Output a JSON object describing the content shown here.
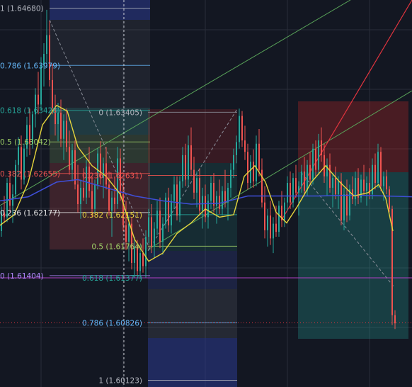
{
  "chart_data": {
    "type": "candlestick",
    "price_axis": {
      "min": 1.6004,
      "max": 1.6478
    },
    "grid": true,
    "colors": {
      "background": "#131722",
      "grid": "#2a2e39",
      "up": "#26a69a",
      "down": "#ef5350",
      "sma_fast": "#e6d53c",
      "sma_slow": "#3f4fd8",
      "trend_green": "#5aa55a",
      "trend_red": "#e0343e",
      "dashed": "#8a8e99",
      "fib_labels": [
        "#b2b5be",
        "#64b5f6",
        "#26a69a",
        "#9ccc65",
        "#ef5350",
        "#e8e8e8",
        "#b388ff"
      ]
    },
    "fib_left": [
      {
        "label": "1 (1.64680)",
        "price": 1.6468
      },
      {
        "label": "0.786 (1.63979)",
        "price": 1.63979
      },
      {
        "label": "0.618 (1.63428)",
        "price": 1.63428
      },
      {
        "label": "0.5 (1.63042)",
        "price": 1.63042
      },
      {
        "label": "0.382 (1.62655)",
        "price": 1.62655
      },
      {
        "label": "0.236 (1.62177)",
        "price": 1.62177
      },
      {
        "label": "0 (1.61404)",
        "price": 1.61404
      }
    ],
    "fib_mid": [
      {
        "label": "0 (1.63405)",
        "price": 1.63405
      },
      {
        "label": "0.236 (1.62631)",
        "price": 1.62631
      },
      {
        "label": "0.382 (1.62151)",
        "price": 1.62151
      },
      {
        "label": "0.5 (1.61764)",
        "price": 1.61764
      },
      {
        "label": "0.618 (1.61377)",
        "price": 1.61377
      },
      {
        "label": "0.786 (1.60826)",
        "price": 1.60826
      },
      {
        "label": "1 (1.60123)",
        "price": 1.60123
      }
    ],
    "horizontal_levels": {
      "magenta": 1.61377,
      "red_dotted": 1.60826
    },
    "sma_fast": [
      [
        0,
        1.6202
      ],
      [
        20,
        1.6215
      ],
      [
        40,
        1.6255
      ],
      [
        60,
        1.6325
      ],
      [
        80,
        1.6349
      ],
      [
        95,
        1.6342
      ],
      [
        110,
        1.6298
      ],
      [
        130,
        1.6275
      ],
      [
        150,
        1.6262
      ],
      [
        170,
        1.624
      ],
      [
        190,
        1.6185
      ],
      [
        210,
        1.6158
      ],
      [
        230,
        1.6168
      ],
      [
        250,
        1.6192
      ],
      [
        270,
        1.6205
      ],
      [
        290,
        1.6222
      ],
      [
        310,
        1.6212
      ],
      [
        330,
        1.6215
      ],
      [
        345,
        1.6262
      ],
      [
        360,
        1.6275
      ],
      [
        375,
        1.6255
      ],
      [
        390,
        1.6218
      ],
      [
        405,
        1.6205
      ],
      [
        420,
        1.6225
      ],
      [
        440,
        1.6255
      ],
      [
        460,
        1.6275
      ],
      [
        480,
        1.6255
      ],
      [
        500,
        1.6238
      ],
      [
        520,
        1.6242
      ],
      [
        535,
        1.6252
      ],
      [
        545,
        1.6235
      ],
      [
        555,
        1.6195
      ]
    ],
    "sma_slow": [
      [
        0,
        1.6232
      ],
      [
        40,
        1.6237
      ],
      [
        80,
        1.6255
      ],
      [
        110,
        1.6258
      ],
      [
        150,
        1.6248
      ],
      [
        190,
        1.6238
      ],
      [
        230,
        1.6232
      ],
      [
        270,
        1.6228
      ],
      [
        310,
        1.6229
      ],
      [
        350,
        1.6238
      ],
      [
        400,
        1.6238
      ],
      [
        450,
        1.6238
      ],
      [
        500,
        1.6239
      ],
      [
        545,
        1.6238
      ],
      [
        582,
        1.6237
      ]
    ],
    "ohlc": [
      [
        2,
        1.6195,
        1.6225,
        1.6188,
        1.6218
      ],
      [
        6,
        1.6218,
        1.6238,
        1.6205,
        1.6212
      ],
      [
        10,
        1.6212,
        1.626,
        1.6206,
        1.6254
      ],
      [
        14,
        1.6254,
        1.6268,
        1.6218,
        1.6226
      ],
      [
        18,
        1.6226,
        1.6252,
        1.6205,
        1.624
      ],
      [
        22,
        1.624,
        1.6282,
        1.6234,
        1.6276
      ],
      [
        26,
        1.6276,
        1.631,
        1.6262,
        1.6298
      ],
      [
        30,
        1.6298,
        1.6312,
        1.6246,
        1.6258
      ],
      [
        34,
        1.6258,
        1.6302,
        1.6252,
        1.6296
      ],
      [
        38,
        1.6296,
        1.6335,
        1.6286,
        1.6325
      ],
      [
        42,
        1.6325,
        1.6345,
        1.6288,
        1.6302
      ],
      [
        46,
        1.6302,
        1.6342,
        1.6296,
        1.6338
      ],
      [
        50,
        1.6338,
        1.637,
        1.6322,
        1.6362
      ],
      [
        54,
        1.6362,
        1.639,
        1.6338,
        1.635
      ],
      [
        58,
        1.635,
        1.6408,
        1.6344,
        1.6398
      ],
      [
        62,
        1.6398,
        1.6425,
        1.6372,
        1.6412
      ],
      [
        66,
        1.6412,
        1.6466,
        1.6395,
        1.6435
      ],
      [
        70,
        1.6435,
        1.6452,
        1.6372,
        1.638
      ],
      [
        74,
        1.638,
        1.64,
        1.6338,
        1.6346
      ],
      [
        78,
        1.6346,
        1.6362,
        1.6312,
        1.6326
      ],
      [
        82,
        1.6326,
        1.6352,
        1.6305,
        1.634
      ],
      [
        86,
        1.634,
        1.6356,
        1.6298,
        1.6308
      ],
      [
        90,
        1.6308,
        1.6338,
        1.6282,
        1.633
      ],
      [
        94,
        1.633,
        1.6345,
        1.6292,
        1.6298
      ],
      [
        98,
        1.6298,
        1.6318,
        1.6264,
        1.627
      ],
      [
        102,
        1.627,
        1.6302,
        1.6256,
        1.6294
      ],
      [
        106,
        1.6294,
        1.6306,
        1.6246,
        1.6252
      ],
      [
        110,
        1.6252,
        1.6276,
        1.6218,
        1.6228
      ],
      [
        114,
        1.6228,
        1.6258,
        1.621,
        1.6248
      ],
      [
        118,
        1.6248,
        1.6272,
        1.6232,
        1.6236
      ],
      [
        122,
        1.6236,
        1.6282,
        1.6228,
        1.6274
      ],
      [
        126,
        1.6274,
        1.6298,
        1.6236,
        1.6244
      ],
      [
        130,
        1.6244,
        1.6262,
        1.6212,
        1.6222
      ],
      [
        134,
        1.6222,
        1.6258,
        1.6216,
        1.6252
      ],
      [
        138,
        1.6252,
        1.6296,
        1.6246,
        1.629
      ],
      [
        142,
        1.629,
        1.6305,
        1.6252,
        1.626
      ],
      [
        146,
        1.626,
        1.6285,
        1.6235,
        1.6278
      ],
      [
        150,
        1.6278,
        1.6298,
        1.6246,
        1.6252
      ],
      [
        154,
        1.6252,
        1.6268,
        1.6214,
        1.622
      ],
      [
        158,
        1.622,
        1.6244,
        1.6188,
        1.6236
      ],
      [
        162,
        1.6236,
        1.6262,
        1.6218,
        1.6228
      ],
      [
        166,
        1.6228,
        1.6298,
        1.6222,
        1.6284
      ],
      [
        170,
        1.6284,
        1.6296,
        1.6232,
        1.624
      ],
      [
        174,
        1.624,
        1.6256,
        1.6195,
        1.6202
      ],
      [
        178,
        1.6202,
        1.6232,
        1.6172,
        1.6182
      ],
      [
        182,
        1.6182,
        1.6214,
        1.6158,
        1.6204
      ],
      [
        186,
        1.6204,
        1.6212,
        1.6148,
        1.6156
      ],
      [
        190,
        1.6156,
        1.6188,
        1.6138,
        1.6176
      ],
      [
        194,
        1.6176,
        1.6184,
        1.614,
        1.6146
      ],
      [
        198,
        1.6146,
        1.6178,
        1.6136,
        1.6168
      ],
      [
        202,
        1.6168,
        1.6186,
        1.6144,
        1.6152
      ],
      [
        206,
        1.6152,
        1.6196,
        1.6138,
        1.6188
      ],
      [
        210,
        1.6188,
        1.6222,
        1.618,
        1.6212
      ],
      [
        214,
        1.6212,
        1.6228,
        1.6168,
        1.6176
      ],
      [
        218,
        1.6176,
        1.6206,
        1.6162,
        1.6198
      ],
      [
        222,
        1.6198,
        1.6232,
        1.619,
        1.622
      ],
      [
        226,
        1.622,
        1.6236,
        1.6174,
        1.6182
      ],
      [
        230,
        1.6182,
        1.6212,
        1.6166,
        1.6204
      ],
      [
        234,
        1.6204,
        1.6242,
        1.6198,
        1.6236
      ],
      [
        238,
        1.6236,
        1.6248,
        1.6194,
        1.6202
      ],
      [
        242,
        1.6202,
        1.624,
        1.6192,
        1.6232
      ],
      [
        246,
        1.6232,
        1.6262,
        1.6222,
        1.6252
      ],
      [
        250,
        1.6252,
        1.6262,
        1.6208,
        1.6214
      ],
      [
        254,
        1.6214,
        1.6262,
        1.6206,
        1.6256
      ],
      [
        258,
        1.6256,
        1.6298,
        1.6248,
        1.6288
      ],
      [
        262,
        1.6288,
        1.6302,
        1.625,
        1.6258
      ],
      [
        266,
        1.6258,
        1.6312,
        1.625,
        1.63
      ],
      [
        270,
        1.63,
        1.6322,
        1.6262,
        1.627
      ],
      [
        274,
        1.627,
        1.6286,
        1.6234,
        1.6242
      ],
      [
        278,
        1.6242,
        1.6268,
        1.6224,
        1.626
      ],
      [
        282,
        1.626,
        1.6272,
        1.6214,
        1.622
      ],
      [
        286,
        1.622,
        1.6248,
        1.6198,
        1.6238
      ],
      [
        290,
        1.6238,
        1.6252,
        1.6206,
        1.6212
      ],
      [
        294,
        1.6212,
        1.624,
        1.6198,
        1.6232
      ],
      [
        298,
        1.6232,
        1.6262,
        1.6222,
        1.6254
      ],
      [
        302,
        1.6254,
        1.6266,
        1.6218,
        1.6226
      ],
      [
        306,
        1.6226,
        1.6244,
        1.6204,
        1.6238
      ],
      [
        310,
        1.6238,
        1.6258,
        1.6216,
        1.6222
      ],
      [
        314,
        1.6222,
        1.625,
        1.6214,
        1.6244
      ],
      [
        318,
        1.6244,
        1.627,
        1.6224,
        1.623
      ],
      [
        322,
        1.623,
        1.6254,
        1.6208,
        1.6248
      ],
      [
        326,
        1.6248,
        1.6278,
        1.6236,
        1.627
      ],
      [
        330,
        1.627,
        1.6296,
        1.626,
        1.6288
      ],
      [
        334,
        1.6288,
        1.6312,
        1.6278,
        1.6304
      ],
      [
        338,
        1.6304,
        1.6345,
        1.6296,
        1.6336
      ],
      [
        342,
        1.6336,
        1.6342,
        1.6298,
        1.6306
      ],
      [
        346,
        1.6306,
        1.6324,
        1.6282,
        1.6292
      ],
      [
        350,
        1.6292,
        1.6302,
        1.6246,
        1.6254
      ],
      [
        354,
        1.6254,
        1.6288,
        1.6248,
        1.628
      ],
      [
        358,
        1.628,
        1.6295,
        1.6248,
        1.6256
      ],
      [
        362,
        1.6256,
        1.6312,
        1.625,
        1.6302
      ],
      [
        366,
        1.6302,
        1.632,
        1.6262,
        1.627
      ],
      [
        370,
        1.627,
        1.6284,
        1.6224,
        1.623
      ],
      [
        374,
        1.623,
        1.625,
        1.6186,
        1.6196
      ],
      [
        378,
        1.6196,
        1.6222,
        1.6176,
        1.6214
      ],
      [
        382,
        1.6214,
        1.6232,
        1.6178,
        1.6186
      ],
      [
        386,
        1.6186,
        1.6212,
        1.6168,
        1.6204
      ],
      [
        390,
        1.6204,
        1.6226,
        1.6188,
        1.6194
      ],
      [
        394,
        1.6194,
        1.6232,
        1.6188,
        1.6226
      ],
      [
        398,
        1.6226,
        1.6244,
        1.62,
        1.6208
      ],
      [
        402,
        1.6208,
        1.6236,
        1.62,
        1.623
      ],
      [
        406,
        1.623,
        1.6262,
        1.622,
        1.6254
      ],
      [
        410,
        1.6254,
        1.6268,
        1.6222,
        1.623
      ],
      [
        414,
        1.623,
        1.6266,
        1.6224,
        1.626
      ],
      [
        418,
        1.626,
        1.6276,
        1.6236,
        1.6242
      ],
      [
        422,
        1.6242,
        1.6256,
        1.6214,
        1.625
      ],
      [
        426,
        1.625,
        1.6276,
        1.6242,
        1.6268
      ],
      [
        430,
        1.6268,
        1.6286,
        1.6238,
        1.6244
      ],
      [
        434,
        1.6244,
        1.6282,
        1.6238,
        1.6276
      ],
      [
        438,
        1.6276,
        1.6292,
        1.6252,
        1.6258
      ],
      [
        442,
        1.6258,
        1.6302,
        1.6252,
        1.6296
      ],
      [
        446,
        1.6296,
        1.6306,
        1.6262,
        1.627
      ],
      [
        450,
        1.627,
        1.6314,
        1.6264,
        1.6306
      ],
      [
        454,
        1.6306,
        1.6322,
        1.628,
        1.6288
      ],
      [
        458,
        1.6288,
        1.6302,
        1.6254,
        1.6262
      ],
      [
        462,
        1.6262,
        1.6284,
        1.6238,
        1.6276
      ],
      [
        466,
        1.6276,
        1.629,
        1.6242,
        1.6248
      ],
      [
        470,
        1.6248,
        1.6266,
        1.6224,
        1.626
      ],
      [
        474,
        1.626,
        1.6274,
        1.6234,
        1.624
      ],
      [
        478,
        1.624,
        1.6262,
        1.6222,
        1.6256
      ],
      [
        482,
        1.6256,
        1.6266,
        1.6202,
        1.6208
      ],
      [
        486,
        1.6208,
        1.6248,
        1.6196,
        1.624
      ],
      [
        490,
        1.624,
        1.6258,
        1.6206,
        1.6214
      ],
      [
        494,
        1.6214,
        1.6252,
        1.6208,
        1.6246
      ],
      [
        498,
        1.6246,
        1.6262,
        1.6228,
        1.6234
      ],
      [
        502,
        1.6234,
        1.6268,
        1.6226,
        1.626
      ],
      [
        506,
        1.626,
        1.6272,
        1.6228,
        1.6236
      ],
      [
        510,
        1.6236,
        1.6264,
        1.623,
        1.6258
      ],
      [
        514,
        1.6258,
        1.6276,
        1.6238,
        1.6244
      ],
      [
        518,
        1.6244,
        1.6262,
        1.6226,
        1.6254
      ],
      [
        522,
        1.6254,
        1.6272,
        1.6234,
        1.624
      ],
      [
        526,
        1.624,
        1.6284,
        1.6234,
        1.6276
      ],
      [
        530,
        1.6276,
        1.629,
        1.6246,
        1.6254
      ],
      [
        534,
        1.6254,
        1.6302,
        1.6248,
        1.6292
      ],
      [
        538,
        1.6292,
        1.6298,
        1.6244,
        1.625
      ],
      [
        542,
        1.625,
        1.6268,
        1.6232,
        1.6262
      ],
      [
        546,
        1.6262,
        1.627,
        1.624,
        1.6246
      ],
      [
        550,
        1.6246,
        1.625,
        1.6218,
        1.6222
      ],
      [
        554,
        1.6222,
        1.6226,
        1.608,
        1.6092
      ],
      [
        558,
        1.6092,
        1.6098,
        1.6075,
        1.6082
      ]
    ]
  }
}
